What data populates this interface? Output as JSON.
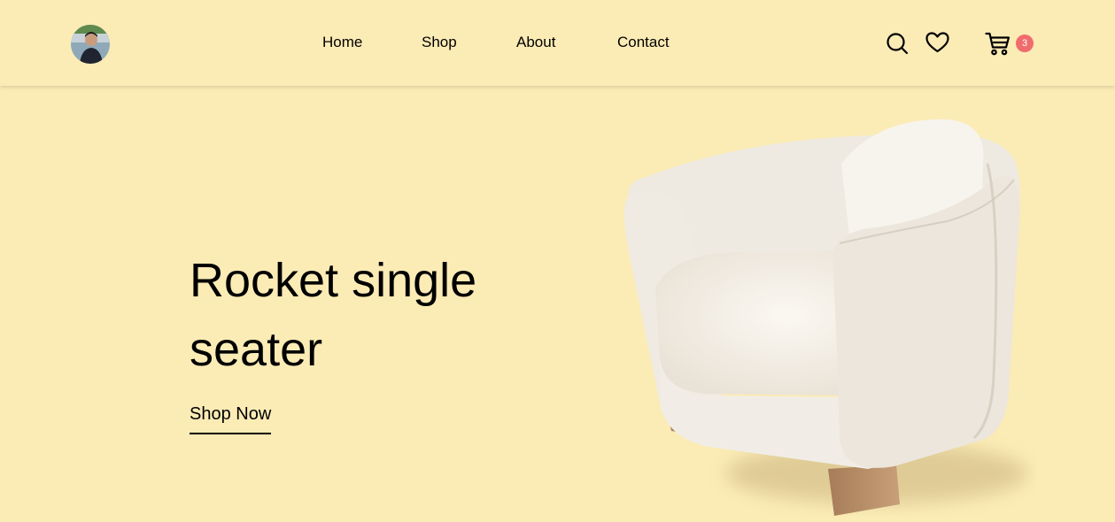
{
  "header": {
    "avatar_alt": "profile avatar",
    "nav": [
      {
        "label": "Home"
      },
      {
        "label": "Shop"
      },
      {
        "label": "About"
      },
      {
        "label": "Contact"
      }
    ],
    "icons": [
      "search-icon",
      "heart-icon",
      "cart-icon"
    ],
    "cart_count": "3"
  },
  "hero": {
    "title": "Rocket single seater",
    "cta": "Shop Now",
    "image_alt": "white single seater armchair"
  },
  "colors": {
    "background": "#fbebb5",
    "badge": "#f06c6c",
    "text": "#000000"
  }
}
